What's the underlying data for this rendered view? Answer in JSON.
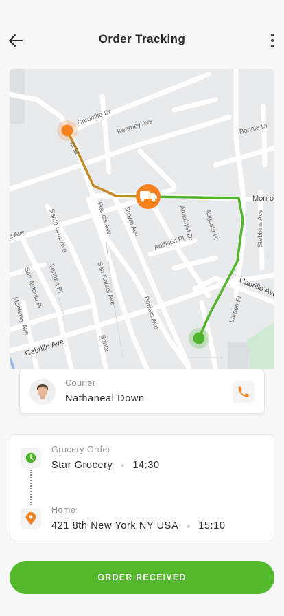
{
  "header": {
    "title": "Order Tracking",
    "back_icon": "arrow-left-icon",
    "menu_icon": "more-vertical-icon"
  },
  "map": {
    "streets": {
      "chromite": "Chromite Dr",
      "kearney": "Kearney Ave",
      "bonnie": "Bonnie Dr",
      "monroe": "Monro",
      "francis": "Francis Ave",
      "brown": "Brown Ave",
      "amethyst": "Amethyst Dr",
      "augusta": "Augusta Pl",
      "stebbins": "Stebbins Ave",
      "addison": "Addison Pl",
      "santa_cruz": "Santa Cruz Ave",
      "ventura": "Ventura Pl",
      "san_antonio": "San Antonio Pl",
      "monterey": "Monterey Ave",
      "san_rafael": "San Rafael Ave",
      "cabrillo_left": "Cabrillo Ave",
      "cabrillo_right": "Cabrillo Ave",
      "larsen": "Larsen Pl",
      "santa": "Santa",
      "bowers": "Bowers Ave",
      "via": "ia Ave",
      "top_vertical": "rs St"
    },
    "route_colors": {
      "start": "#f5821f",
      "end": "#4db42c"
    },
    "marker_icon": "delivery-truck-icon"
  },
  "courier": {
    "role": "Courier",
    "name": "Nathaneal Down",
    "call_icon": "phone-icon"
  },
  "order": {
    "pickup": {
      "label": "Grocery Order",
      "place": "Star Grocery",
      "time": "14:30",
      "icon": "clock-icon"
    },
    "dropoff": {
      "label": "Home",
      "place": "421 8th New York NY USA",
      "time": "15:10",
      "icon": "location-pin-icon"
    }
  },
  "cta": {
    "label": "ORDER RECEIVED"
  },
  "colors": {
    "accent": "#53b82b",
    "orange": "#f5821f",
    "green": "#4db42c"
  }
}
